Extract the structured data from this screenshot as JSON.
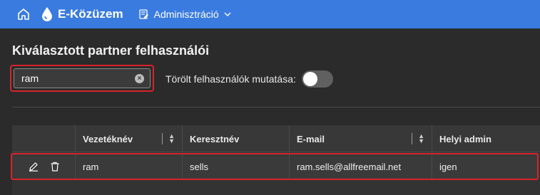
{
  "topbar": {
    "brand": "E-Közüzem",
    "admin_menu": "Adminisztráció",
    "icons": {
      "home": "home-icon",
      "logo": "drop-icon",
      "admin": "admin-icon",
      "chevron": "chevron-down-icon"
    },
    "color": "#3a7be0"
  },
  "page": {
    "title": "Kiválasztott partner felhasználói"
  },
  "search": {
    "value": "ram",
    "placeholder": ""
  },
  "toggle": {
    "label": "Törölt felhasználók mutatása:",
    "on": false
  },
  "table": {
    "columns": [
      "Vezetéknév",
      "Keresztnév",
      "E-mail",
      "Helyi admin"
    ],
    "rows": [
      {
        "last_name": "ram",
        "first_name": "sells",
        "email": "ram.sells@allfreemail.net",
        "local_admin": "igen"
      }
    ]
  }
}
